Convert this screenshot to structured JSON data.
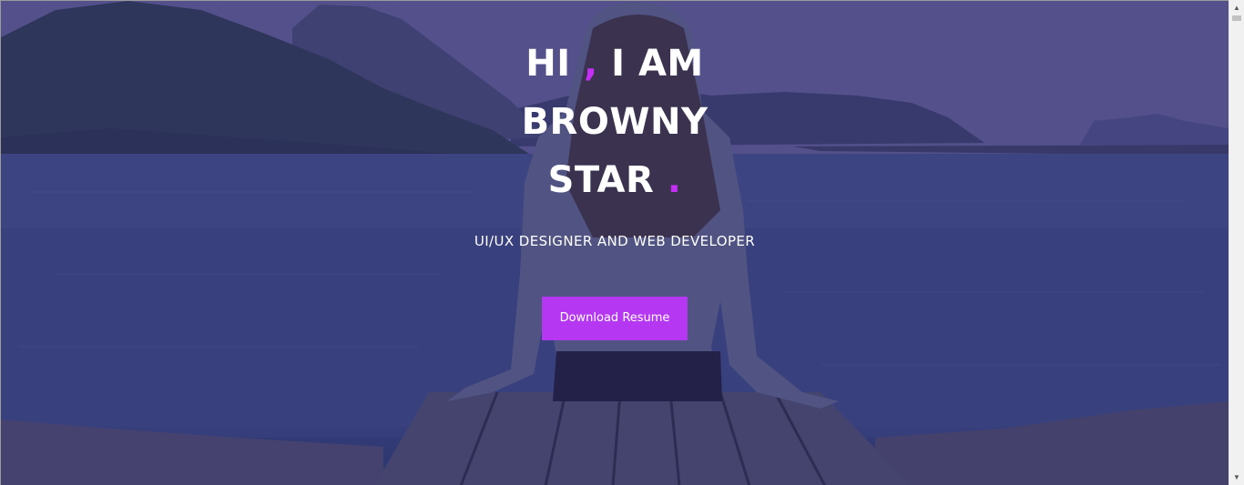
{
  "hero": {
    "headline": {
      "line1_before": "HI",
      "line1_comma": " ,",
      "line1_after": " I AM",
      "line2": "BROWNY",
      "line3": "STAR",
      "line3_dot": " ."
    },
    "subtitle": "UI/UX DESIGNER AND WEB DEVELOPER",
    "cta_label": "Download Resume"
  },
  "colors": {
    "accent": "#c32ff5",
    "button": "#b537f2",
    "overlay": "#302a78"
  },
  "icons": {
    "scroll_up": "triangle-up-icon",
    "scroll_down": "triangle-down-icon"
  }
}
